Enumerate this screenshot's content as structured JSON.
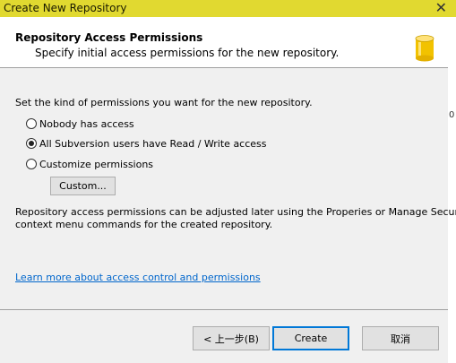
{
  "window": {
    "title": "Create New Repository",
    "close_glyph": "✕"
  },
  "header": {
    "title": "Repository Access Permissions",
    "subtitle": "Specify initial access permissions for the new repository.",
    "icon": "database-icon"
  },
  "main": {
    "instruction": "Set the kind of permissions you want for the new repository.",
    "options": [
      {
        "label": "Nobody has access",
        "checked": false
      },
      {
        "label": "All Subversion users have Read / Write access",
        "checked": true
      },
      {
        "label": "Customize permissions",
        "checked": false
      }
    ],
    "custom_button": "Custom...",
    "note_line1": "Repository access permissions can be adjusted later using the Properies or Manage Security",
    "note_line2": "context menu commands for the created repository.",
    "learn_more_link": "Learn more about access control and permissions"
  },
  "footer": {
    "back_button": "< 上一步(B)",
    "create_button": "Create",
    "cancel_button": "取消"
  },
  "colors": {
    "titlebar": "#e1d930",
    "link": "#0066cc",
    "primary_border": "#0078d7"
  }
}
